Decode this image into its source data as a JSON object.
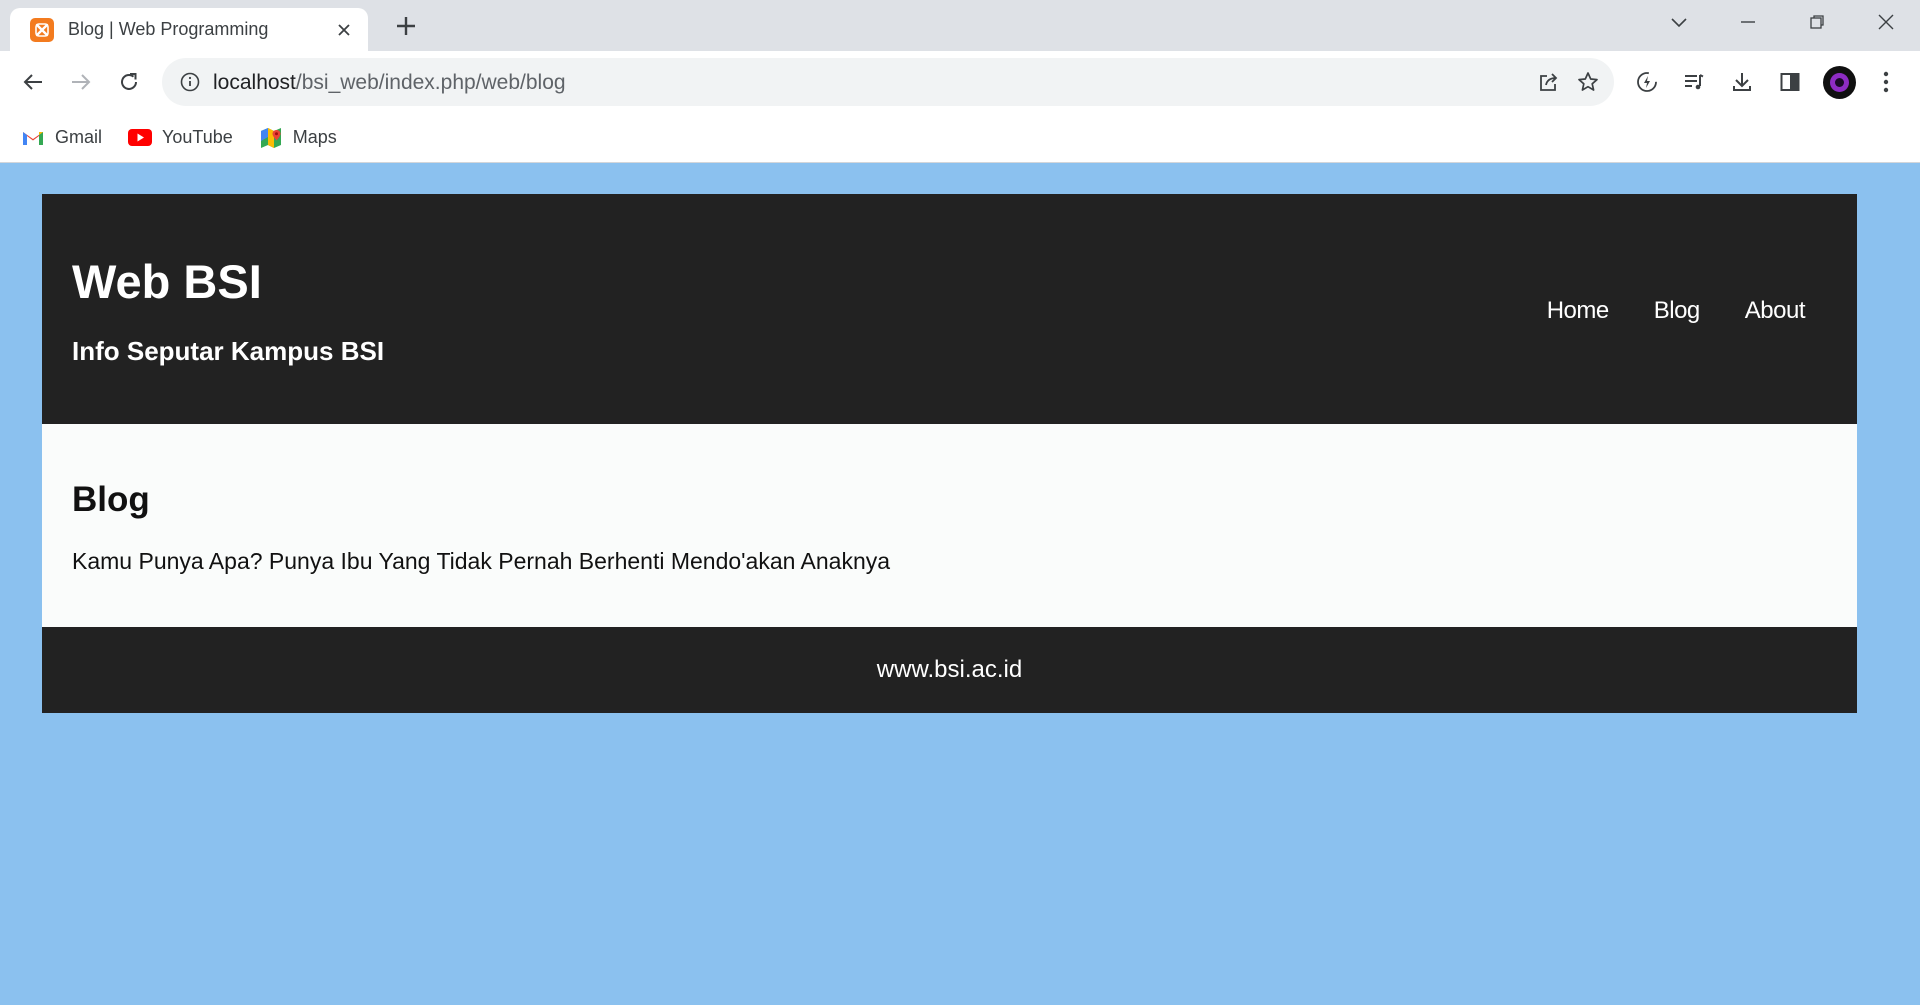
{
  "browser": {
    "tab": {
      "title": "Blog | Web Programming",
      "favicon": "xampp-icon"
    },
    "address_bar": {
      "host": "localhost",
      "path": "/bsi_web/index.php/web/blog"
    },
    "bookmarks": [
      {
        "label": "Gmail",
        "icon": "gmail-icon"
      },
      {
        "label": "YouTube",
        "icon": "youtube-icon"
      },
      {
        "label": "Maps",
        "icon": "maps-icon"
      }
    ]
  },
  "site": {
    "title": "Web BSI",
    "tagline": "Info Seputar Kampus BSI",
    "nav": {
      "home": "Home",
      "blog": "Blog",
      "about": "About"
    },
    "main": {
      "heading": "Blog",
      "text": "Kamu Punya Apa? Punya Ibu Yang Tidak Pernah Berhenti Mendo'akan Anaknya"
    },
    "footer": "www.bsi.ac.id"
  },
  "colors": {
    "page_background": "#8bc1ef",
    "header_footer": "#222222",
    "content": "#fafcfb"
  }
}
